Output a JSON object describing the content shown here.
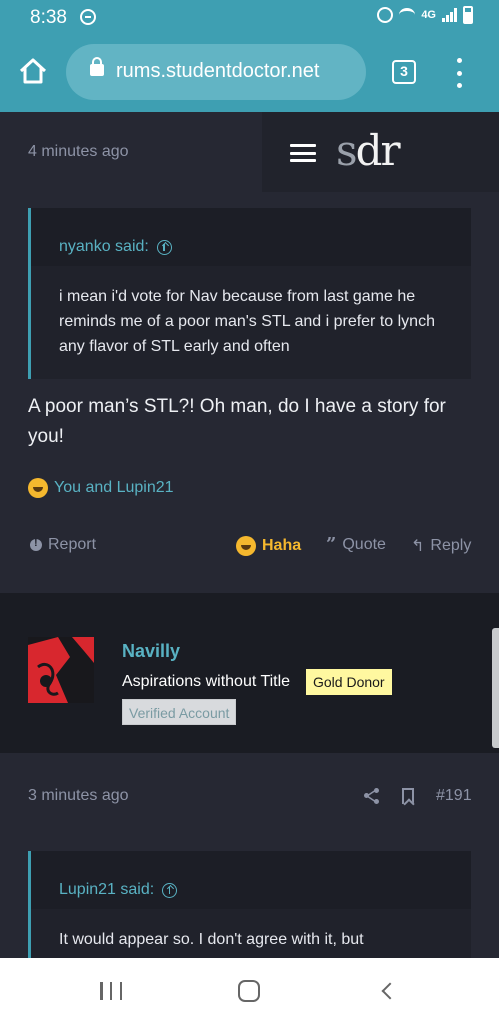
{
  "status_bar": {
    "time": "8:38",
    "network": "4G"
  },
  "browser": {
    "url": "rums.studentdoctor.net",
    "tab_count": "3"
  },
  "site": {
    "logo_s": "s",
    "logo_dr": "dr"
  },
  "post1": {
    "time": "4 minutes ago",
    "quote_author": "nyanko said:",
    "quote_text": "i mean i'd vote for Nav because from last game he reminds me of a poor man's STL and i prefer to lynch any flavor of STL early and often",
    "body": "A poor man’s STL?! Oh man, do I have a story for you!",
    "reactions": "You and Lupin21",
    "actions": {
      "report": "Report",
      "haha": "Haha",
      "quote": "Quote",
      "reply": "Reply"
    }
  },
  "user": {
    "name": "Navilly",
    "title": "Aspirations without Title",
    "badge_gold": "Gold Donor",
    "badge_verified": "Verified Account"
  },
  "post2": {
    "time": "3 minutes ago",
    "number": "#191",
    "quote_author": "Lupin21 said:",
    "quote_text": "It would appear so. I don't agree with it, but"
  },
  "colors": {
    "accent": "#3e9fb2",
    "link": "#59b2c3",
    "background": "#262833",
    "gold": "#f5b82e"
  }
}
